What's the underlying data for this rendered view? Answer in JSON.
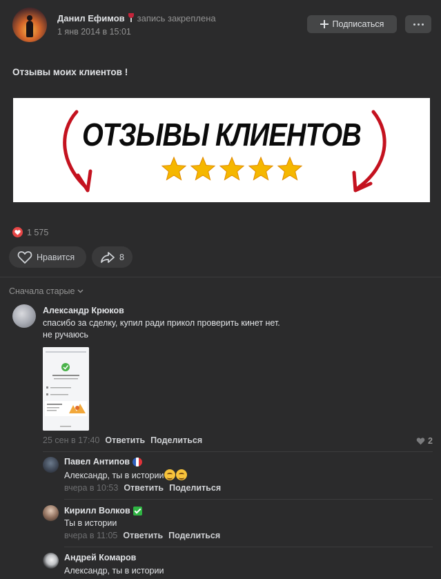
{
  "post": {
    "author": "Данил Ефимов",
    "pinned_label": "запись закреплена",
    "date": "1 янв 2014 в 15:01",
    "subscribe_label": "Подписаться",
    "text": "Отзывы моих клиентов !",
    "banner_title": "ОТЗЫВЫ КЛИЕНТОВ",
    "banner_stars": 5,
    "likes_count": "1 575",
    "like_label": "Нравится",
    "shares_count": "8"
  },
  "comments": {
    "sort_label": "Сначала старые",
    "items": [
      {
        "author": "Александр Крюков",
        "text_line1": "спасибо за сделку, купил ради прикол проверить кинет нет.",
        "text_line2": "не ручаюсь",
        "time": "25 сен в 17:40",
        "reply_label": "Ответить",
        "share_label": "Поделиться",
        "likes": "2"
      },
      {
        "author": "Павел Антипов",
        "text": "Александр, ты в истории",
        "time": "вчера в 10:53",
        "reply_label": "Ответить",
        "share_label": "Поделиться"
      },
      {
        "author": "Кирилл Волков",
        "text": "Ты в истории",
        "time": "вчера в 11:05",
        "reply_label": "Ответить",
        "share_label": "Поделиться"
      },
      {
        "author": "Андрей Комаров",
        "text": "Александр, ты в истории"
      }
    ]
  },
  "colors": {
    "background": "#2b2b2c",
    "heart": "#e64646",
    "check_badge": "#2fb443",
    "star": "#f5b700"
  }
}
